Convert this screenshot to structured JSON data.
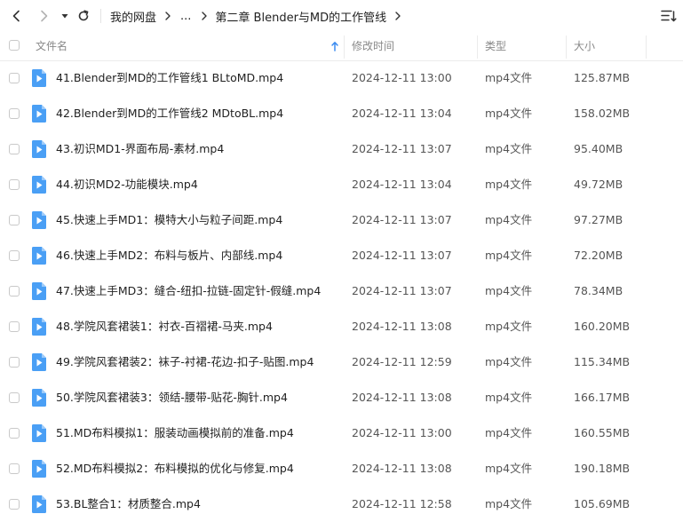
{
  "toolbar": {
    "back_icon": "chevron-left-icon",
    "forward_icon": "chevron-right-icon",
    "dropdown_icon": "caret-down-icon",
    "refresh_icon": "refresh-icon",
    "sort_icon": "sort-list-icon"
  },
  "breadcrumb": {
    "root": "我的网盘",
    "ellipsis": "...",
    "current": "第二章 Blender与MD的工作管线"
  },
  "columns": {
    "name": "文件名",
    "modified": "修改时间",
    "type": "类型",
    "size": "大小"
  },
  "colors": {
    "accent": "#3c8cf0",
    "file_icon": "#4a9ff5"
  },
  "files": [
    {
      "name": "41.Blender到MD的工作管线1 BLtoMD.mp4",
      "modified": "2024-12-11 13:00",
      "type": "mp4文件",
      "size": "125.87MB"
    },
    {
      "name": "42.Blender到MD的工作管线2 MDtoBL.mp4",
      "modified": "2024-12-11 13:04",
      "type": "mp4文件",
      "size": "158.02MB"
    },
    {
      "name": "43.初识MD1-界面布局-素材.mp4",
      "modified": "2024-12-11 13:07",
      "type": "mp4文件",
      "size": "95.40MB"
    },
    {
      "name": "44.初识MD2-功能模块.mp4",
      "modified": "2024-12-11 13:04",
      "type": "mp4文件",
      "size": "49.72MB"
    },
    {
      "name": "45.快速上手MD1：模特大小与粒子间距.mp4",
      "modified": "2024-12-11 13:07",
      "type": "mp4文件",
      "size": "97.27MB"
    },
    {
      "name": "46.快速上手MD2：布料与板片、内部线.mp4",
      "modified": "2024-12-11 13:07",
      "type": "mp4文件",
      "size": "72.20MB"
    },
    {
      "name": "47.快速上手MD3：缝合-纽扣-拉链-固定针-假缝.mp4",
      "modified": "2024-12-11 13:07",
      "type": "mp4文件",
      "size": "78.34MB"
    },
    {
      "name": "48.学院风套裙装1：衬衣-百褶裙-马夹.mp4",
      "modified": "2024-12-11 13:08",
      "type": "mp4文件",
      "size": "160.20MB"
    },
    {
      "name": "49.学院风套裙装2：袜子-衬裙-花边-扣子-贴图.mp4",
      "modified": "2024-12-11 12:59",
      "type": "mp4文件",
      "size": "115.34MB"
    },
    {
      "name": "50.学院风套裙装3：领结-腰带-贴花-胸针.mp4",
      "modified": "2024-12-11 13:08",
      "type": "mp4文件",
      "size": "166.17MB"
    },
    {
      "name": "51.MD布料模拟1：服装动画模拟前的准备.mp4",
      "modified": "2024-12-11 13:00",
      "type": "mp4文件",
      "size": "160.55MB"
    },
    {
      "name": "52.MD布料模拟2：布料模拟的优化与修复.mp4",
      "modified": "2024-12-11 13:08",
      "type": "mp4文件",
      "size": "190.18MB"
    },
    {
      "name": "53.BL整合1：材质整合.mp4",
      "modified": "2024-12-11 12:58",
      "type": "mp4文件",
      "size": "105.69MB"
    }
  ]
}
